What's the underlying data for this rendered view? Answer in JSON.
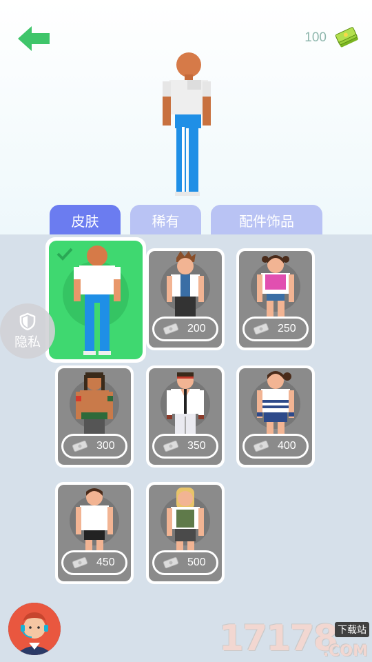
{
  "header": {
    "coins": "100",
    "back_icon": "back-arrow-icon",
    "cash_icon": "cash-stack-icon"
  },
  "tabs": [
    {
      "label": "皮肤",
      "active": true
    },
    {
      "label": "稀有",
      "active": false
    },
    {
      "label": "配件饰品",
      "active": false
    }
  ],
  "skins": [
    {
      "price": null,
      "selected": true
    },
    {
      "price": "200"
    },
    {
      "price": "250"
    },
    {
      "price": "300"
    },
    {
      "price": "350"
    },
    {
      "price": "400"
    },
    {
      "price": "450"
    },
    {
      "price": "500"
    }
  ],
  "privacy": {
    "label": "隐私",
    "icon": "shield-icon"
  },
  "watermark": {
    "main": "17178",
    "small": "下载站",
    "suffix": ".COM"
  },
  "colors": {
    "tab_active": "#6b7cf0",
    "tab_inactive": "#b9c3f4",
    "selected_card": "#3fd870",
    "back_arrow": "#3fc56a"
  }
}
